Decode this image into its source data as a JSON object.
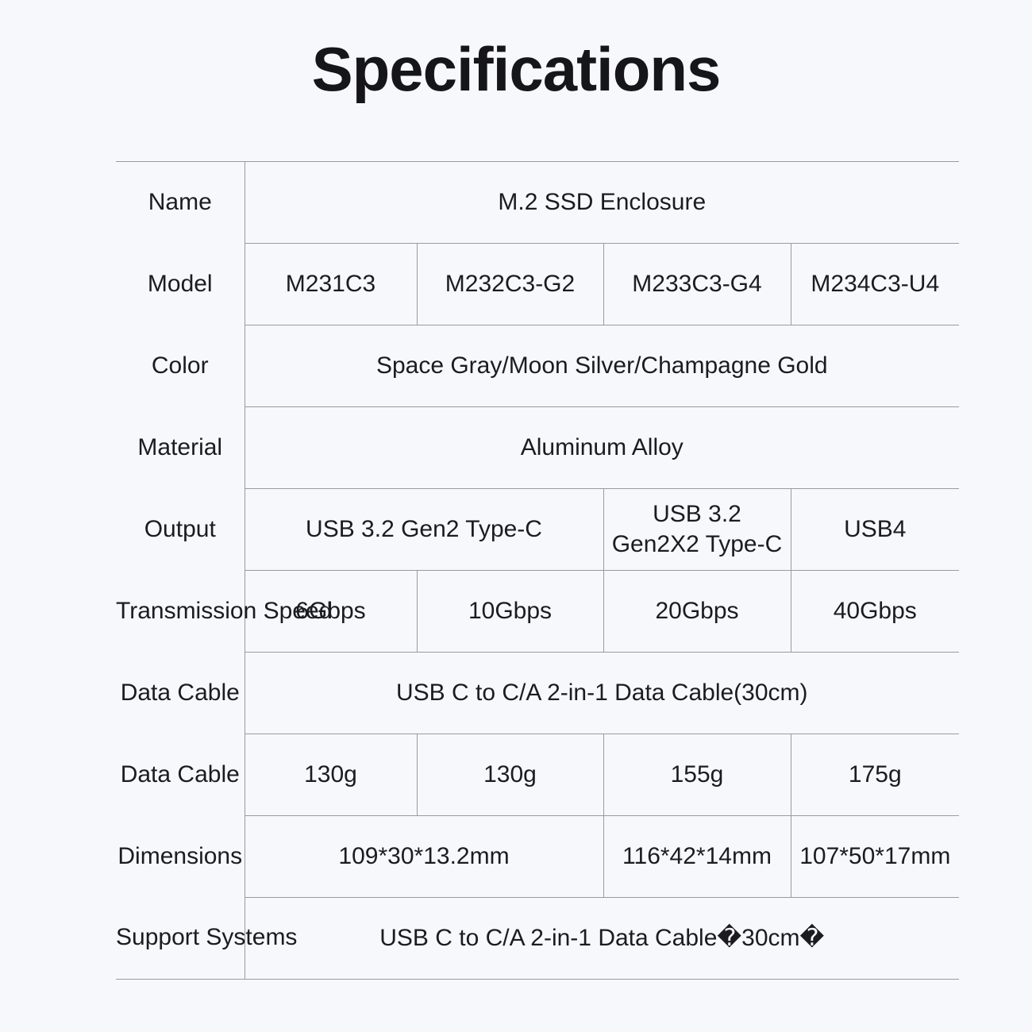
{
  "document": {
    "title": "Specifications",
    "background_color": "#f7f8fc",
    "border_color": "#9a9aa2",
    "text_color": "#1c1c1e"
  },
  "table": {
    "column_count": 4,
    "rows": [
      {
        "label": "Name",
        "cells": [
          {
            "text": "M.2 SSD Enclosure",
            "span": 4
          }
        ]
      },
      {
        "label": "Model",
        "cells": [
          {
            "text": "M231C3",
            "span": 1
          },
          {
            "text": "M232C3-G2",
            "span": 1
          },
          {
            "text": "M233C3-G4",
            "span": 1
          },
          {
            "text": "M234C3-U4",
            "span": 1
          }
        ]
      },
      {
        "label": "Color",
        "cells": [
          {
            "text": "Space Gray/Moon Silver/Champagne Gold",
            "span": 4
          }
        ]
      },
      {
        "label": "Material",
        "cells": [
          {
            "text": "Aluminum Alloy",
            "span": 4
          }
        ]
      },
      {
        "label": "Output",
        "cells": [
          {
            "text": "USB 3.2 Gen2 Type-C",
            "span": 2
          },
          {
            "line1": "USB 3.2",
            "line2": "Gen2X2 Type-C",
            "span": 1
          },
          {
            "text": "USB4",
            "span": 1
          }
        ]
      },
      {
        "label": "Transmission Speed",
        "cells": [
          {
            "text": "6Gbps",
            "span": 1
          },
          {
            "text": "10Gbps",
            "span": 1
          },
          {
            "text": "20Gbps",
            "span": 1
          },
          {
            "text": "40Gbps",
            "span": 1
          }
        ]
      },
      {
        "label": "Data Cable",
        "cells": [
          {
            "text": "USB C to C/A 2-in-1 Data Cable(30cm)",
            "span": 4
          }
        ]
      },
      {
        "label": "Data Cable",
        "cells": [
          {
            "text": "130g",
            "span": 1
          },
          {
            "text": "130g",
            "span": 1
          },
          {
            "text": "155g",
            "span": 1
          },
          {
            "text": "175g",
            "span": 1
          }
        ]
      },
      {
        "label": "Dimensions",
        "cells": [
          {
            "text": "109*30*13.2mm",
            "span": 2
          },
          {
            "text": "116*42*14mm",
            "span": 1
          },
          {
            "text": "107*50*17mm",
            "span": 1
          }
        ]
      },
      {
        "label": "Support Systems",
        "cells": [
          {
            "text": "USB C to C/A 2-in-1 Data Cable�30cm�",
            "span": 4
          }
        ]
      }
    ]
  }
}
